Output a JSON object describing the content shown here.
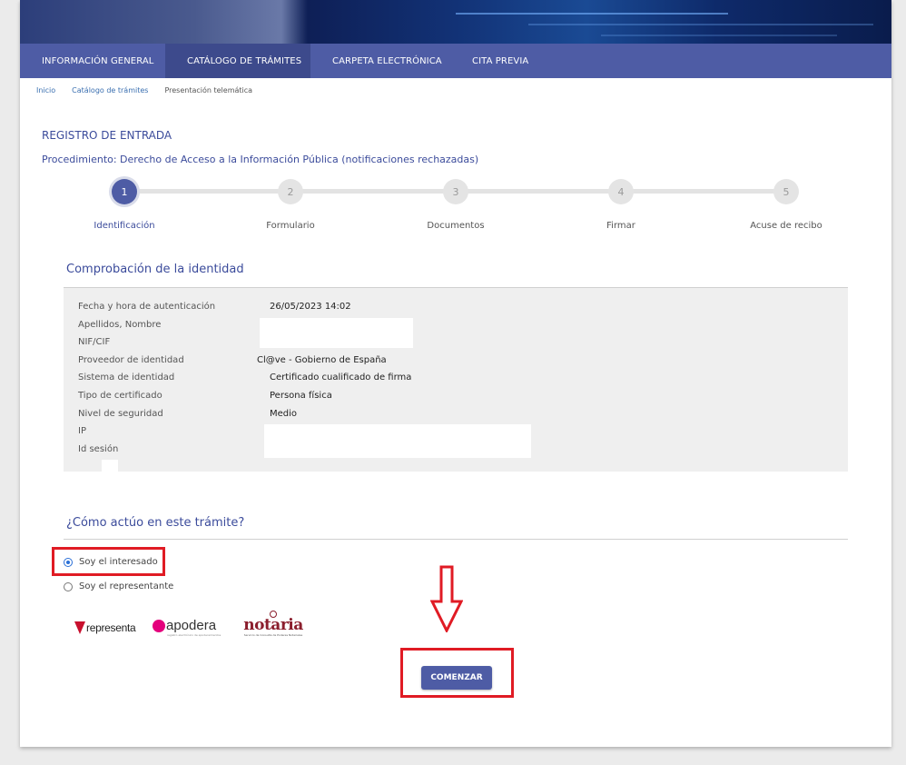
{
  "nav": [
    {
      "label": "INFORMACIÓN GENERAL",
      "active": false
    },
    {
      "label": "CATÁLOGO DE TRÁMITES",
      "active": true
    },
    {
      "label": "CARPETA ELECTRÓNICA",
      "active": false
    },
    {
      "label": "CITA PREVIA",
      "active": false
    }
  ],
  "breadcrumb": {
    "home": "Inicio",
    "catalog": "Catálogo de trámites",
    "current": "Presentación telemática"
  },
  "page_title": "REGISTRO DE ENTRADA",
  "procedure": "Procedimiento: Derecho de Acceso a la Información Pública (notificaciones rechazadas)",
  "steps": [
    {
      "number": "1",
      "label": "Identificación",
      "active": true
    },
    {
      "number": "2",
      "label": "Formulario",
      "active": false
    },
    {
      "number": "3",
      "label": "Documentos",
      "active": false
    },
    {
      "number": "4",
      "label": "Firmar",
      "active": false
    },
    {
      "number": "5",
      "label": "Acuse de recibo",
      "active": false
    }
  ],
  "identity": {
    "heading": "Comprobación de la identidad",
    "rows": [
      {
        "label": "Fecha y hora de autenticación",
        "value": "26/05/2023 14:02"
      },
      {
        "label": "Apellidos, Nombre",
        "value": ""
      },
      {
        "label": "NIF/CIF",
        "value": ""
      },
      {
        "label": "Proveedor de identidad",
        "value": "Cl@ve - Gobierno de España"
      },
      {
        "label": "Sistema de identidad",
        "value": "Certificado cualificado de firma"
      },
      {
        "label": "Tipo de certificado",
        "value": "Persona física"
      },
      {
        "label": "Nivel de seguridad",
        "value": "Medio"
      },
      {
        "label": "IP",
        "value": ""
      },
      {
        "label": "Id sesión",
        "value": ""
      }
    ]
  },
  "acting": {
    "heading": "¿Cómo actúo en este trámite?",
    "options": [
      {
        "label": "Soy el interesado",
        "checked": true
      },
      {
        "label": "Soy el representante",
        "checked": false
      }
    ]
  },
  "logos": {
    "representa": "representa",
    "apodera": "apodera",
    "apodera_sub": "registro electrónico de apoderamientos",
    "notaria": "notaria",
    "notaria_sub": "Servicio de Consulta de Poderes Notariales"
  },
  "start_button": "COMENZAR",
  "colors": {
    "primary": "#4e5ca5",
    "nav_active": "#3d4a8c",
    "heading": "#3b4b9b",
    "highlight": "#e01b24"
  }
}
